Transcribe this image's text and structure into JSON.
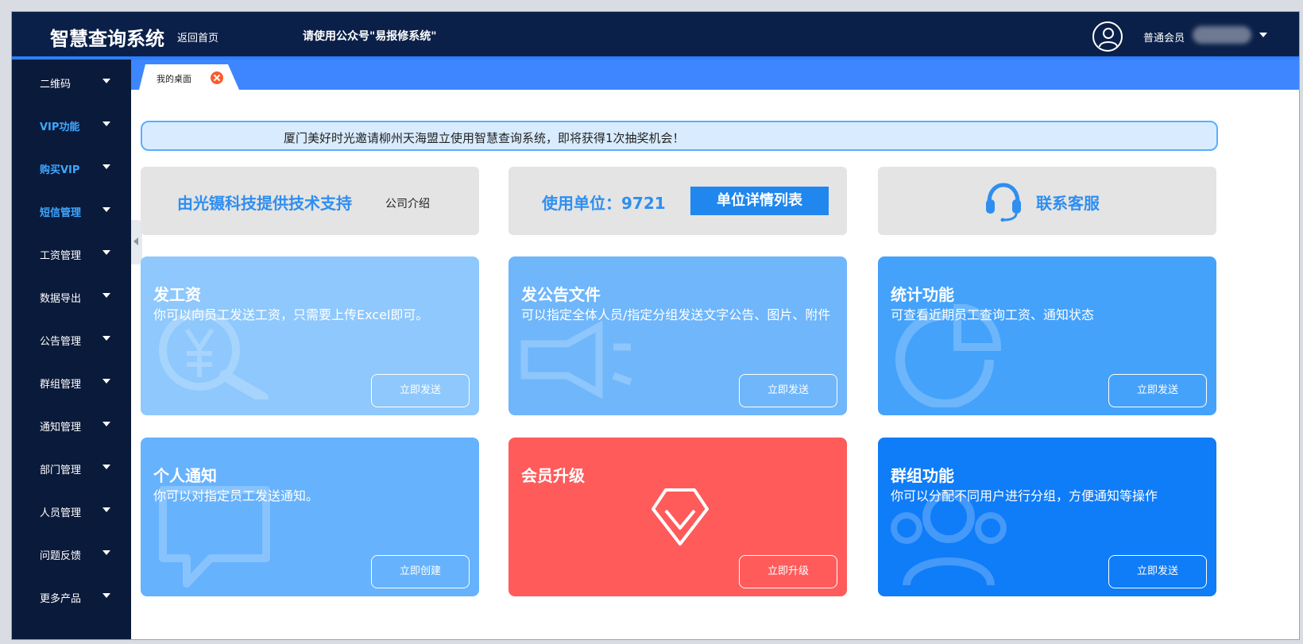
{
  "header": {
    "title": "智慧查询系统",
    "home_link": "返回首页",
    "notice": "请使用公众号\"易报修系统\"",
    "member_label": "普通会员"
  },
  "sidebar": {
    "items": [
      {
        "label": "二维码",
        "highlight": false
      },
      {
        "label": "VIP功能",
        "highlight": true
      },
      {
        "label": "购买VIP",
        "highlight": true
      },
      {
        "label": "短信管理",
        "highlight": true
      },
      {
        "label": "工资管理",
        "highlight": false
      },
      {
        "label": "数据导出",
        "highlight": false
      },
      {
        "label": "公告管理",
        "highlight": false
      },
      {
        "label": "群组管理",
        "highlight": false
      },
      {
        "label": "通知管理",
        "highlight": false
      },
      {
        "label": "部门管理",
        "highlight": false
      },
      {
        "label": "人员管理",
        "highlight": false
      },
      {
        "label": "问题反馈",
        "highlight": false
      },
      {
        "label": "更多产品",
        "highlight": false
      }
    ]
  },
  "tabs": [
    {
      "label": "我的桌面"
    }
  ],
  "banner": {
    "text": "厦门美好时光邀请柳州天海盟立使用智慧查询系统，即将获得1次抽奖机会！"
  },
  "info": {
    "support_text": "由光镊科技提供技术支持",
    "company_link": "公司介绍",
    "units_text": "使用单位：9721",
    "units_button": "单位详情列表",
    "service_text": "联系客服"
  },
  "cards": [
    {
      "title": "发工资",
      "desc": "你可以向员工发送工资，只需要上传Excel即可。",
      "button": "立即发送",
      "icon": "yuan-search-icon"
    },
    {
      "title": "发公告文件",
      "desc": "可以指定全体人员/指定分组发送文字公告、图片、附件",
      "button": "立即发送",
      "icon": "announcement-icon"
    },
    {
      "title": "统计功能",
      "desc": "可查看近期员工查询工资、通知状态",
      "button": "立即发送",
      "icon": "pie-chart-icon"
    },
    {
      "title": "个人通知",
      "desc": "你可以对指定员工发送通知。",
      "button": "立即创建",
      "icon": "chat-bubble-icon"
    },
    {
      "title": "会员升级",
      "desc": "",
      "button": "立即升级",
      "icon": "diamond-icon"
    },
    {
      "title": "群组功能",
      "desc": "你可以分配不同用户进行分组，方便通知等操作",
      "button": "立即发送",
      "icon": "users-icon"
    }
  ],
  "colors": {
    "header_bg": "#0b2048",
    "sidebar_bg": "#0a1a3a",
    "tabbar_bg": "#3d86ff",
    "accent": "#2f8ef0",
    "upgrade_red": "#ff5b5b"
  }
}
